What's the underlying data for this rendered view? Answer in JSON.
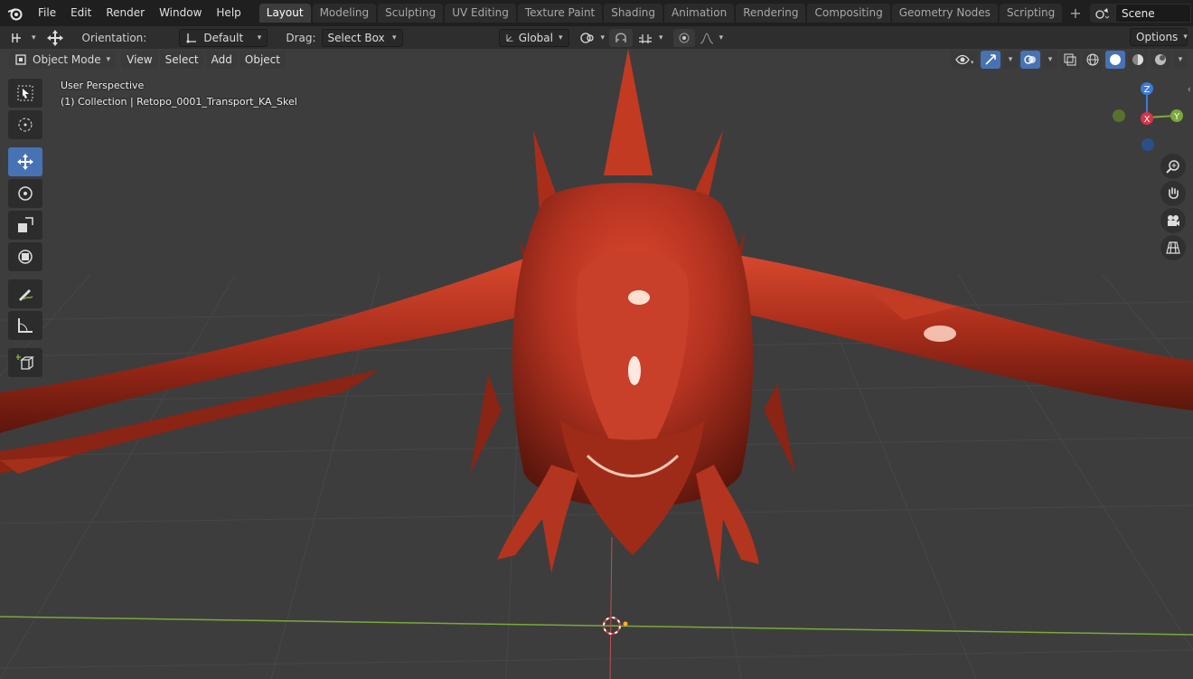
{
  "menu": {
    "items": [
      "File",
      "Edit",
      "Render",
      "Window",
      "Help"
    ]
  },
  "workspaces": {
    "tabs": [
      "Layout",
      "Modeling",
      "Sculpting",
      "UV Editing",
      "Texture Paint",
      "Shading",
      "Animation",
      "Rendering",
      "Compositing",
      "Geometry Nodes",
      "Scripting"
    ],
    "active": "Layout"
  },
  "scene": {
    "name": "Scene"
  },
  "tool_header": {
    "orientation_label": "Orientation:",
    "orientation_value": "Default",
    "drag_label": "Drag:",
    "drag_value": "Select Box",
    "transform_orientation": "Global",
    "options_label": "Options"
  },
  "view_header": {
    "mode": "Object Mode",
    "view": "View",
    "select": "Select",
    "add": "Add",
    "object": "Object"
  },
  "viewport": {
    "perspective": "User Perspective",
    "collection": "(1) Collection | Retopo_0001_Transport_KA_Skel"
  },
  "gizmo": {
    "z": "Z",
    "x": "X",
    "y": "Y"
  },
  "colors": {
    "accent": "#4772b3",
    "model": "#b8321f",
    "grid_bg": "#3d3d3d",
    "axis_x": "#c83c3c",
    "axis_y": "#7aa83c",
    "axis_z": "#3d7ad6"
  }
}
